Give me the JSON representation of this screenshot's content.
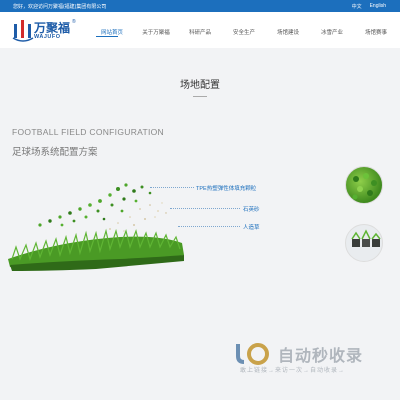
{
  "topbar": {
    "welcome": "您好，欢迎访问万聚福(福建)集团有限公司",
    "lang_cn": "中文",
    "lang_en": "English"
  },
  "logo": {
    "brand_cn": "万聚福",
    "brand_en": "WAJUFO",
    "registered": "®"
  },
  "nav": {
    "items": [
      {
        "label": "网站首页",
        "active": true
      },
      {
        "label": "关于万聚福",
        "active": false
      },
      {
        "label": "科研产品",
        "active": false
      },
      {
        "label": "安全生产",
        "active": false
      },
      {
        "label": "场馆建设",
        "active": false
      },
      {
        "label": "冰雪产业",
        "active": false
      },
      {
        "label": "场馆赛事",
        "active": false
      }
    ]
  },
  "main": {
    "title": "场地配置",
    "en_heading": "FOOTBALL FIELD CONFIGURATION",
    "cn_heading": "足球场系统配置方案",
    "labels": [
      "TPE热塑弹性体填充颗粒",
      "石英砂",
      "人造草"
    ]
  },
  "watermark": {
    "big": "自动秒收录",
    "small": "敢上链接→来访一次→自动收录→"
  },
  "colors": {
    "brand_blue": "#1c6fbd",
    "grass_green": "#4a9a25"
  }
}
